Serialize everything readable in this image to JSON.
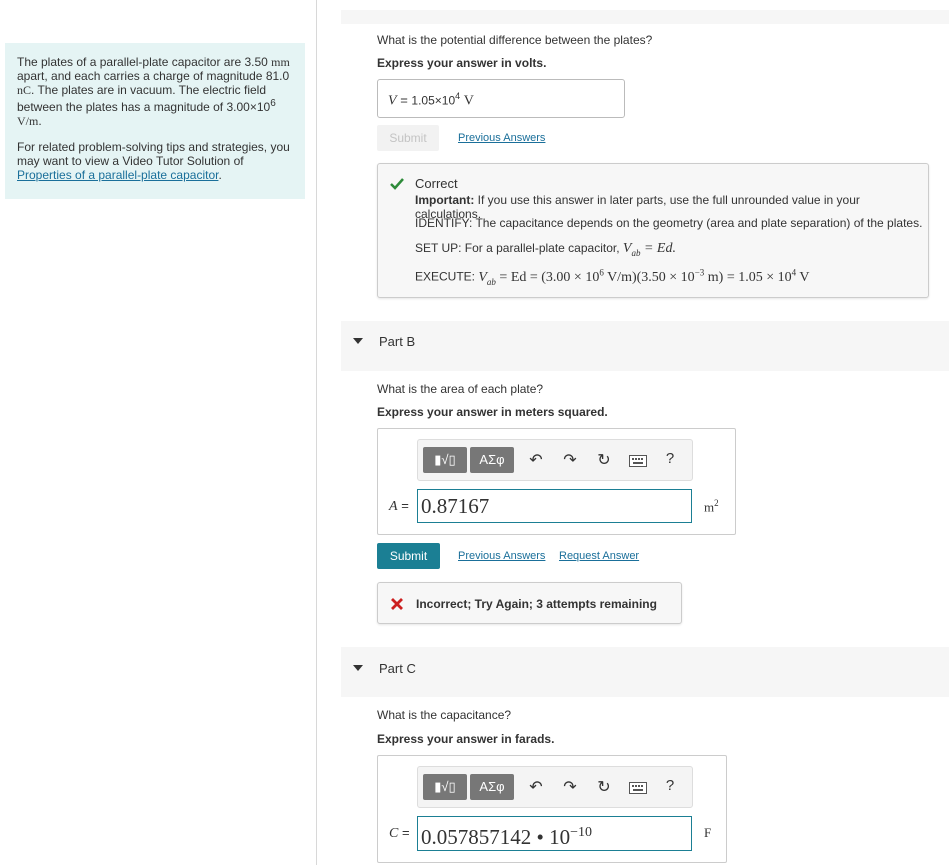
{
  "problem": {
    "text_1": "The plates of a parallel-plate capacitor are 3.50",
    "unit_mm": "mm",
    "text_2": "apart, and each carries a charge of magnitude",
    "charge": "81.0",
    "unit_nc": "nC",
    "text_3": ". The plates are in vacuum. The electric field",
    "text_4": "between the plates has a magnitude of",
    "field_base": "3.00×10",
    "field_exp": "6",
    "field_unit": "V/m",
    "text_5": "For related problem-solving tips and strategies, you",
    "text_6": "may want to view a Video Tutor Solution of",
    "link": "Properties of a parallel-plate capacitor",
    "link_end": "."
  },
  "part_a": {
    "question": "What is the potential difference between the plates?",
    "instruction": "Express your answer in volts.",
    "var": "V",
    "eq": "=",
    "answer_base": "1.05×10",
    "answer_exp": "4",
    "unit": "V",
    "submit": "Submit",
    "previous": "Previous Answers",
    "feedback": {
      "status": "Correct",
      "important_label": "Important:",
      "important_text": "If you use this answer in later parts, use the full unrounded value in your calculations.",
      "identify": "IDENTIFY: The capacitance depends on the geometry (area and plate separation) of the plates.",
      "setup_prefix": "SET UP: For a parallel-plate capacitor,",
      "setup_eq": "V",
      "setup_sub": "ab",
      "setup_rest": " = Ed.",
      "execute_prefix": "EXECUTE:",
      "execute_eq_1": "V",
      "execute_eq_sub": "ab",
      "execute_eq_2": " = Ed = (3.00 × 10",
      "execute_exp_1": "6",
      "execute_eq_3": " V/m)(3.50 × 10",
      "execute_exp_2": "−3",
      "execute_eq_4": " m) = 1.05 × 10",
      "execute_exp_3": "4",
      "execute_eq_5": " V"
    }
  },
  "part_b": {
    "title": "Part B",
    "question": "What is the area of each plate?",
    "instruction": "Express your answer in meters squared.",
    "var": "A",
    "eq": "=",
    "value": "0.87167",
    "unit_base": "m",
    "unit_exp": "2",
    "submit": "Submit",
    "previous": "Previous Answers",
    "request": "Request Answer",
    "feedback": "Incorrect; Try Again; 3 attempts remaining"
  },
  "part_c": {
    "title": "Part C",
    "question": "What is the capacitance?",
    "instruction": "Express your answer in farads.",
    "var": "C",
    "eq": "=",
    "value": "0.057857142 • 10",
    "value_exp": "−10",
    "unit": "F"
  },
  "toolbar": {
    "templates": "▮√▯",
    "symbols": "ΑΣφ",
    "help": "?"
  },
  "colors": {
    "accent": "#1b7f94",
    "correct": "#2e8b3a",
    "incorrect": "#cc1f1f",
    "panel_bg": "#e5f4f4"
  }
}
